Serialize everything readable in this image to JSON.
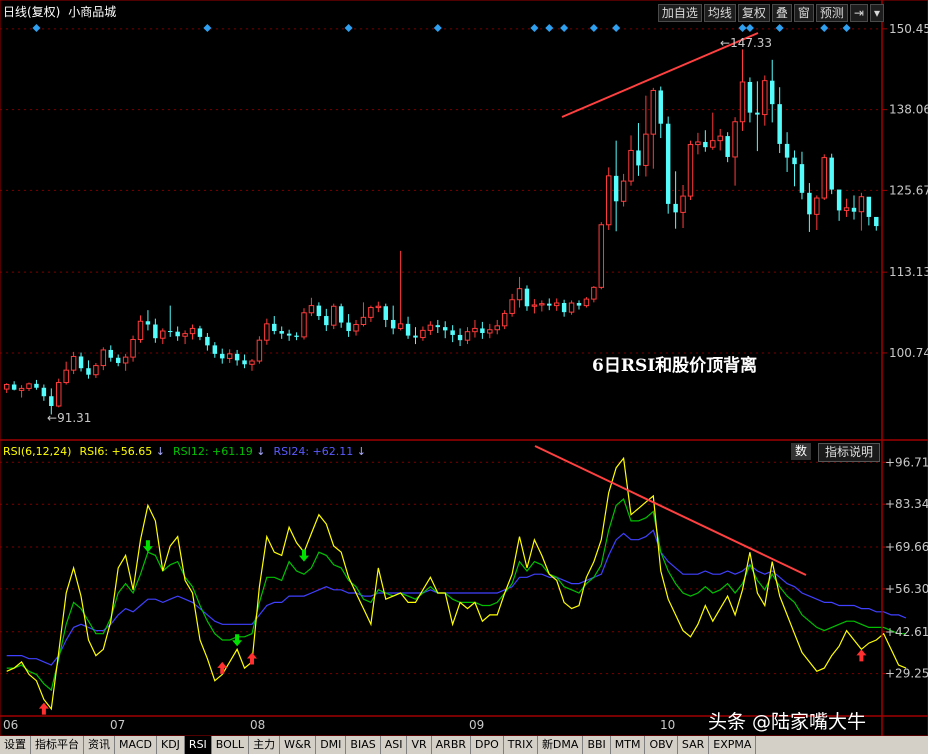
{
  "header": {
    "title": "日线(复权)",
    "stock_name": "小商品城"
  },
  "toolbar": [
    "加自选",
    "均线",
    "复权",
    "叠",
    "窗",
    "预测",
    "⇥",
    "▾"
  ],
  "price_panel": {
    "annotation": "6日RSI和股价顶背离",
    "high_label": "147.33",
    "low_label": "91.31"
  },
  "rsi_panel": {
    "label": "RSI(6,12,24)",
    "rsi6": "RSI6: +56.65",
    "rsi12": "RSI12: +61.19",
    "rsi24": "RSI24: +62.11",
    "shu_button": "数",
    "explain_button": "指标说明"
  },
  "x_axis_labels": [
    "06",
    "07",
    "08",
    "09",
    "10"
  ],
  "tabs": [
    "设置",
    "指标平台",
    "资讯",
    "MACD",
    "KDJ",
    "RSI",
    "BOLL",
    "主力",
    "W&R",
    "DMI",
    "BIAS",
    "ASI",
    "VR",
    "ARBR",
    "DPO",
    "TRIX",
    "新DMA",
    "BBI",
    "MTM",
    "OBV",
    "SAR",
    "EXPMA"
  ],
  "active_tab": "RSI",
  "watermark": "头条 @陆家嘴大牛",
  "colors": {
    "up": "#ff3b3b",
    "down": "#54fcfc",
    "rsi6": "#ffff00",
    "rsi12": "#00c000",
    "rsi24": "#4040ff",
    "trend": "#ff4040"
  },
  "chart_data": [
    {
      "type": "candlestick",
      "title": "日线(复权) 小商品城",
      "y_ticks": [
        150.45,
        138.06,
        125.67,
        113.13,
        100.74
      ],
      "ylim": [
        88,
        151.5
      ],
      "ohlc": [
        [
          95.2,
          96.1,
          94.6,
          95.9
        ],
        [
          95.9,
          96.4,
          95.0,
          95.1
        ],
        [
          95.0,
          95.8,
          93.9,
          95.3
        ],
        [
          95.3,
          96.2,
          94.9,
          96.0
        ],
        [
          96.0,
          96.6,
          95.1,
          95.4
        ],
        [
          95.4,
          95.9,
          93.4,
          94.1
        ],
        [
          94.1,
          95.3,
          91.3,
          92.6
        ],
        [
          92.6,
          96.8,
          92.4,
          96.2
        ],
        [
          96.2,
          99.4,
          95.9,
          98.1
        ],
        [
          98.1,
          100.9,
          97.5,
          100.2
        ],
        [
          100.2,
          100.8,
          97.9,
          98.4
        ],
        [
          98.4,
          99.6,
          96.8,
          97.4
        ],
        [
          97.4,
          99.2,
          96.9,
          98.8
        ],
        [
          98.8,
          101.6,
          98.1,
          101.2
        ],
        [
          101.2,
          101.9,
          99.4,
          100.0
        ],
        [
          100.0,
          100.5,
          98.7,
          99.2
        ],
        [
          99.2,
          100.6,
          98.0,
          100.1
        ],
        [
          100.1,
          103.4,
          99.4,
          102.8
        ],
        [
          102.8,
          106.5,
          102.3,
          105.6
        ],
        [
          105.6,
          107.3,
          104.2,
          105.1
        ],
        [
          105.1,
          106.0,
          102.3,
          103.0
        ],
        [
          103.0,
          104.5,
          102.1,
          104.1
        ],
        [
          104.1,
          108.0,
          103.2,
          104.0
        ],
        [
          104.0,
          104.8,
          102.6,
          103.3
        ],
        [
          103.3,
          104.2,
          102.1,
          103.7
        ],
        [
          103.7,
          105.1,
          102.8,
          104.5
        ],
        [
          104.5,
          104.9,
          102.7,
          103.2
        ],
        [
          103.2,
          103.8,
          101.1,
          101.9
        ],
        [
          101.9,
          102.4,
          100.0,
          100.6
        ],
        [
          100.6,
          101.4,
          99.1,
          99.9
        ],
        [
          99.9,
          101.3,
          99.2,
          100.6
        ],
        [
          100.6,
          101.2,
          98.8,
          99.6
        ],
        [
          99.6,
          100.5,
          98.4,
          99.0
        ],
        [
          99.0,
          99.8,
          98.0,
          99.5
        ],
        [
          99.5,
          103.3,
          99.1,
          102.7
        ],
        [
          102.7,
          106.0,
          102.0,
          105.2
        ],
        [
          105.2,
          106.4,
          103.6,
          104.1
        ],
        [
          104.1,
          104.8,
          102.9,
          103.7
        ],
        [
          103.7,
          104.3,
          102.6,
          103.4
        ],
        [
          103.4,
          103.9,
          102.7,
          103.2
        ],
        [
          103.2,
          107.6,
          102.8,
          106.9
        ],
        [
          106.9,
          109.2,
          106.4,
          108.0
        ],
        [
          108.0,
          108.5,
          105.8,
          106.4
        ],
        [
          106.4,
          107.5,
          104.1,
          105.0
        ],
        [
          105.0,
          108.3,
          104.4,
          107.9
        ],
        [
          107.9,
          108.3,
          104.6,
          105.4
        ],
        [
          105.4,
          106.7,
          103.2,
          104.1
        ],
        [
          104.1,
          105.8,
          103.4,
          105.1
        ],
        [
          105.1,
          108.5,
          104.8,
          106.2
        ],
        [
          106.2,
          108.0,
          105.5,
          107.7
        ],
        [
          107.7,
          108.6,
          107.0,
          107.9
        ],
        [
          107.9,
          108.3,
          104.7,
          105.8
        ],
        [
          105.8,
          108.0,
          103.6,
          104.5
        ],
        [
          104.5,
          116.4,
          104.2,
          105.2
        ],
        [
          105.2,
          106.3,
          102.9,
          103.4
        ],
        [
          103.4,
          104.7,
          102.1,
          103.1
        ],
        [
          103.1,
          104.8,
          102.6,
          104.2
        ],
        [
          104.2,
          105.6,
          103.5,
          105.0
        ],
        [
          105.0,
          105.8,
          103.8,
          104.7
        ],
        [
          104.7,
          105.6,
          103.0,
          104.2
        ],
        [
          104.2,
          105.0,
          102.4,
          103.5
        ],
        [
          103.5,
          104.5,
          101.8,
          102.7
        ],
        [
          102.7,
          104.7,
          102.1,
          104.0
        ],
        [
          104.0,
          105.8,
          103.1,
          104.5
        ],
        [
          104.5,
          105.5,
          102.9,
          103.8
        ],
        [
          103.8,
          105.2,
          103.0,
          104.3
        ],
        [
          104.3,
          105.8,
          103.6,
          104.9
        ],
        [
          104.9,
          107.3,
          104.4,
          106.8
        ],
        [
          106.8,
          109.8,
          106.3,
          108.9
        ],
        [
          108.9,
          112.4,
          107.7,
          110.6
        ],
        [
          110.6,
          111.1,
          107.2,
          107.9
        ],
        [
          107.9,
          109.0,
          106.8,
          108.1
        ],
        [
          108.1,
          108.8,
          107.1,
          108.3
        ],
        [
          108.3,
          109.1,
          107.3,
          108.0
        ],
        [
          108.0,
          109.1,
          107.2,
          108.4
        ],
        [
          108.4,
          108.9,
          106.3,
          107.0
        ],
        [
          107.0,
          108.8,
          106.6,
          108.4
        ],
        [
          108.4,
          108.8,
          107.4,
          108.0
        ],
        [
          108.0,
          109.3,
          107.7,
          109.0
        ],
        [
          109.0,
          111.0,
          108.5,
          110.8
        ],
        [
          110.8,
          120.8,
          110.5,
          120.4
        ],
        [
          120.4,
          129.2,
          119.6,
          127.9
        ],
        [
          127.9,
          133.3,
          119.4,
          124.0
        ],
        [
          124.0,
          128.2,
          123.2,
          127.1
        ],
        [
          127.1,
          134.1,
          126.4,
          131.8
        ],
        [
          131.8,
          136.0,
          127.9,
          129.5
        ],
        [
          129.5,
          140.2,
          127.8,
          134.3
        ],
        [
          134.3,
          141.4,
          129.0,
          141.0
        ],
        [
          141.0,
          141.6,
          133.7,
          135.9
        ],
        [
          135.9,
          137.0,
          122.1,
          123.6
        ],
        [
          123.6,
          128.6,
          119.8,
          122.3
        ],
        [
          122.3,
          126.5,
          119.9,
          124.8
        ],
        [
          124.8,
          133.3,
          124.2,
          132.7
        ],
        [
          132.7,
          134.5,
          131.2,
          133.1
        ],
        [
          133.1,
          134.9,
          131.6,
          132.3
        ],
        [
          132.3,
          137.6,
          131.9,
          133.3
        ],
        [
          133.3,
          135.1,
          131.8,
          134.0
        ],
        [
          134.0,
          134.6,
          130.0,
          130.8
        ],
        [
          130.8,
          136.9,
          126.4,
          136.2
        ],
        [
          136.2,
          147.3,
          134.8,
          142.3
        ],
        [
          142.3,
          143.0,
          136.1,
          137.6
        ],
        [
          137.6,
          142.4,
          131.7,
          137.3
        ],
        [
          137.3,
          143.3,
          135.6,
          142.5
        ],
        [
          142.5,
          145.7,
          136.1,
          138.9
        ],
        [
          138.9,
          141.5,
          131.4,
          132.8
        ],
        [
          132.8,
          134.6,
          128.5,
          130.7
        ],
        [
          130.7,
          131.8,
          126.3,
          129.7
        ],
        [
          129.7,
          131.6,
          124.3,
          125.3
        ],
        [
          125.3,
          126.8,
          119.3,
          122.0
        ],
        [
          122.0,
          124.9,
          119.6,
          124.5
        ],
        [
          124.5,
          131.2,
          124.2,
          130.7
        ],
        [
          130.7,
          131.3,
          125.1,
          125.8
        ],
        [
          125.8,
          125.4,
          121.0,
          122.6
        ],
        [
          122.6,
          124.4,
          121.6,
          123.0
        ],
        [
          123.0,
          124.9,
          121.2,
          122.4
        ],
        [
          122.4,
          125.3,
          119.5,
          124.7
        ],
        [
          124.7,
          124.3,
          120.3,
          121.6
        ],
        [
          121.6,
          121.4,
          119.5,
          120.2
        ]
      ]
    },
    {
      "type": "line",
      "title": "RSI(6,12,24)",
      "y_ticks": [
        96.71,
        83.34,
        69.66,
        56.3,
        42.61,
        29.25
      ],
      "ylim": [
        17,
        100
      ],
      "series": [
        {
          "name": "RSI6",
          "color": "#ffff00",
          "values": [
            30,
            31,
            33,
            29,
            27,
            21,
            18,
            36,
            55,
            63,
            54,
            40,
            35,
            37,
            46,
            63,
            67,
            56,
            72,
            83,
            78,
            62,
            70,
            73,
            59,
            55,
            40,
            34,
            27,
            29,
            33,
            37,
            31,
            33,
            57,
            73,
            68,
            67,
            76,
            71,
            68,
            74,
            80,
            77,
            70,
            68,
            60,
            55,
            50,
            45,
            63,
            53,
            54,
            55,
            52,
            52,
            56,
            60,
            55,
            55,
            45,
            52,
            50,
            52,
            46,
            48,
            48,
            55,
            61,
            73,
            63,
            72,
            67,
            61,
            59,
            52,
            50,
            51,
            60,
            65,
            72,
            87,
            95,
            98,
            80,
            82,
            84,
            86,
            62,
            53,
            48,
            43,
            41,
            45,
            51,
            46,
            50,
            54,
            48,
            56,
            68,
            55,
            51,
            65,
            54,
            48,
            42,
            36,
            33,
            30,
            31,
            35,
            38,
            43,
            40,
            37,
            39,
            40,
            42,
            37,
            32,
            31
          ]
        },
        {
          "name": "RSI12",
          "color": "#00c000",
          "values": [
            31,
            31,
            32,
            30,
            29,
            26,
            24,
            34,
            45,
            52,
            50,
            46,
            42,
            42,
            47,
            55,
            58,
            55,
            61,
            68,
            67,
            62,
            64,
            65,
            60,
            57,
            51,
            46,
            42,
            40,
            40,
            41,
            41,
            42,
            52,
            60,
            60,
            59,
            65,
            62,
            61,
            63,
            68,
            67,
            64,
            63,
            59,
            57,
            53,
            52,
            56,
            55,
            54,
            55,
            54,
            53,
            55,
            57,
            55,
            55,
            53,
            52,
            52,
            52,
            51,
            51,
            52,
            55,
            58,
            65,
            62,
            65,
            64,
            61,
            60,
            57,
            56,
            55,
            58,
            60,
            64,
            75,
            83,
            85,
            78,
            78,
            79,
            81,
            68,
            62,
            58,
            55,
            54,
            55,
            57,
            55,
            56,
            58,
            55,
            58,
            64,
            59,
            56,
            61,
            57,
            54,
            52,
            48,
            46,
            44,
            43,
            44,
            45,
            46,
            46,
            45,
            44,
            44,
            44,
            43,
            42,
            42
          ]
        },
        {
          "name": "RSI24",
          "color": "#4040ff",
          "values": [
            35,
            35,
            35,
            34,
            34,
            33,
            32,
            35,
            40,
            44,
            45,
            44,
            43,
            43,
            45,
            48,
            50,
            49,
            51,
            53,
            53,
            52,
            53,
            54,
            53,
            52,
            50,
            48,
            46,
            45,
            45,
            45,
            45,
            45,
            48,
            51,
            52,
            52,
            54,
            54,
            54,
            55,
            56,
            57,
            56,
            56,
            55,
            55,
            54,
            54,
            55,
            55,
            55,
            55,
            55,
            55,
            55,
            56,
            55,
            55,
            55,
            55,
            55,
            55,
            55,
            55,
            55,
            56,
            57,
            60,
            60,
            61,
            61,
            60,
            60,
            59,
            58,
            58,
            59,
            60,
            61,
            67,
            72,
            74,
            72,
            72,
            73,
            75,
            68,
            65,
            63,
            61,
            61,
            61,
            62,
            61,
            61,
            62,
            61,
            62,
            64,
            62,
            61,
            62,
            60,
            58,
            57,
            55,
            54,
            53,
            52,
            52,
            51,
            51,
            51,
            50,
            50,
            49,
            49,
            48,
            48,
            47
          ]
        }
      ]
    }
  ]
}
